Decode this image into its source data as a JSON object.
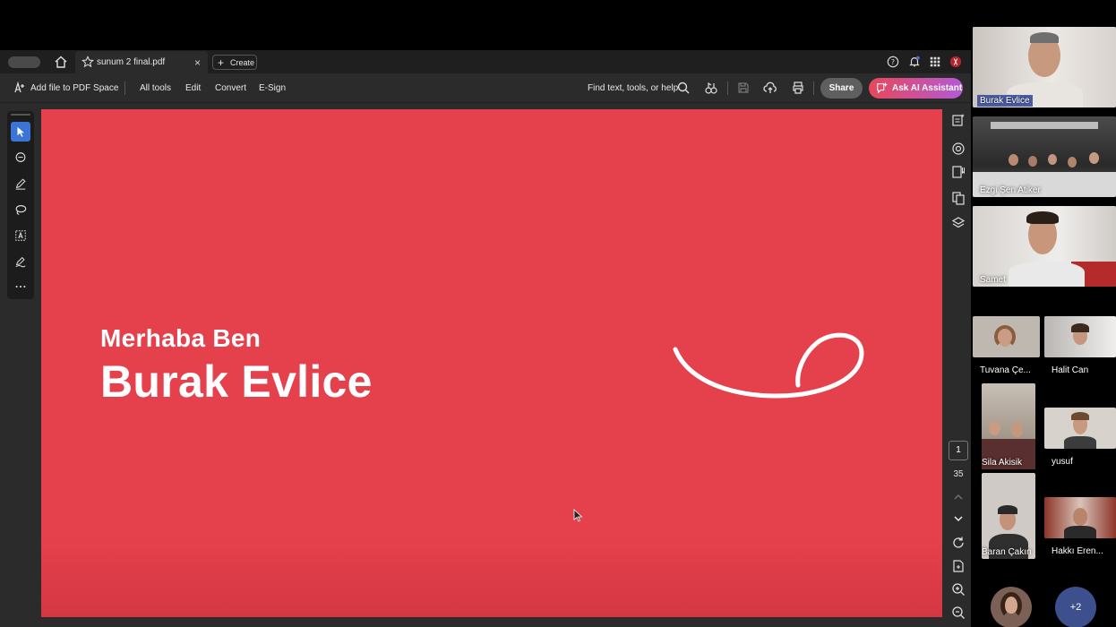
{
  "tabbar": {
    "tab_title": "sunum 2 final.pdf",
    "close_glyph": "×",
    "create_label": "Create"
  },
  "toolbar": {
    "add_file_label": "Add file to PDF Space",
    "all_tools_label": "All tools",
    "edit_label": "Edit",
    "convert_label": "Convert",
    "esign_label": "E-Sign",
    "search_label": "Find text, tools, or help",
    "share_label": "Share",
    "ai_label": "Ask AI Assistant"
  },
  "document": {
    "greeting": "Merhaba Ben",
    "name": "Burak Evlice",
    "background_color": "#e5414c"
  },
  "pagination": {
    "current_page": "1",
    "total_pages": "35"
  },
  "meeting": {
    "participants": [
      {
        "name": "Burak Evlice"
      },
      {
        "name": "Ezgi Şen Atiker"
      },
      {
        "name": "Samet"
      },
      {
        "name": "Tuvana Çe..."
      },
      {
        "name": "Halit Can"
      },
      {
        "name": "Sila Akisik"
      },
      {
        "name": "yusuf"
      },
      {
        "name": "Baran Çakın"
      },
      {
        "name": "Hakkı Eren..."
      }
    ],
    "more_count": "+2"
  }
}
